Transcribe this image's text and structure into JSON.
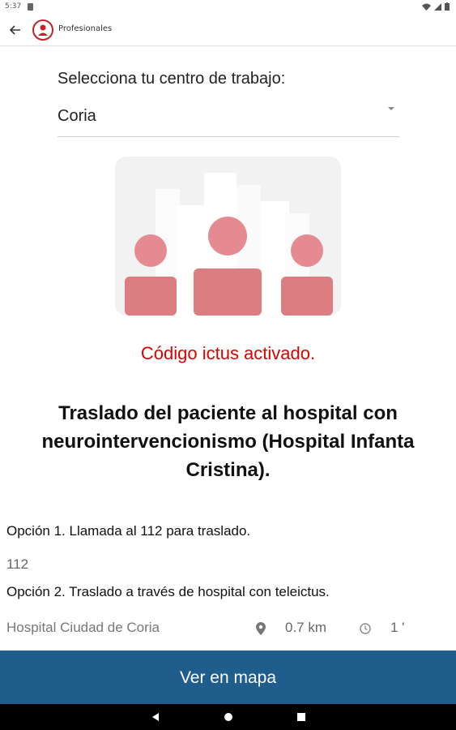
{
  "status_bar": {
    "time": "5:37"
  },
  "app_bar": {
    "title": "Profesionales"
  },
  "form": {
    "label": "Selecciona tu centro de trabajo:",
    "selected_center": "Coria"
  },
  "status_message": "Código ictus activado.",
  "headline": "Traslado del paciente al hospital con neurointervencionismo (Hospital Infanta Cristina).",
  "option1": "Opción 1. Llamada al 112 para traslado.",
  "phone": "112",
  "option2": "Opción 2. Traslado a través de hospital con teleictus.",
  "hospital": {
    "name": "Hospital Ciudad de Coria",
    "distance": "0.7 km",
    "time": "1 '"
  },
  "map_button": "Ver en mapa",
  "colors": {
    "accent": "#1f5d8c",
    "status_red": "#e00000"
  }
}
